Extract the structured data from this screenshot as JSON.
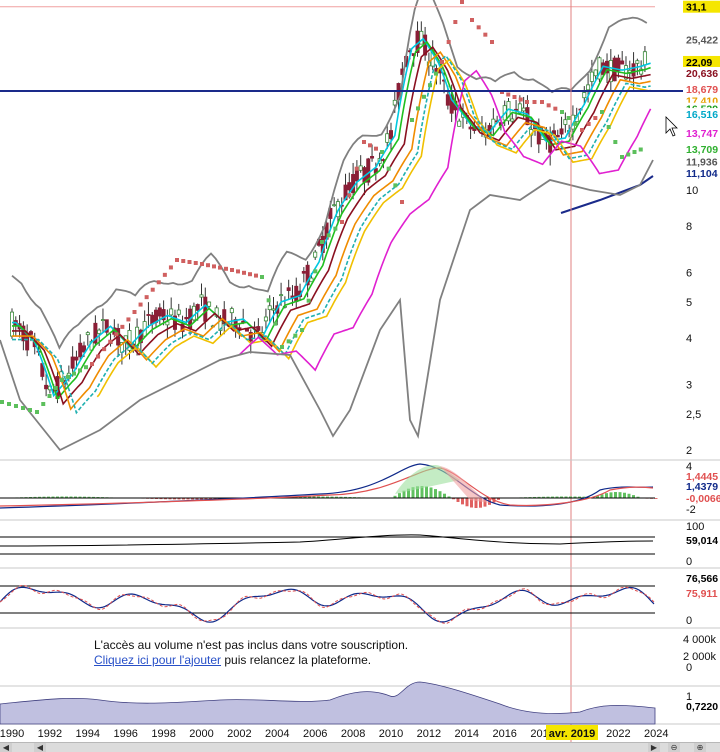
{
  "chart_data": [
    {
      "type": "candlestick",
      "panel": "price",
      "scale": "log",
      "ylim": [
        2,
        31.1
      ],
      "yticks": [
        2,
        2.5,
        3,
        4,
        5,
        6,
        8,
        10
      ],
      "x_ticks": [
        "1990",
        "1992",
        "1994",
        "1996",
        "1998",
        "2000",
        "2002",
        "2004",
        "2006",
        "2008",
        "2010",
        "2012",
        "2014",
        "2016",
        "2018",
        "2020",
        "2022",
        "2024"
      ],
      "cursor_label": "avr. 2019",
      "horizontal_levels": [
        31.1,
        18.67
      ],
      "value_tags": [
        {
          "text": "31,1",
          "value": 31.1,
          "bg": "#f5e600",
          "fg": "#000000"
        },
        {
          "text": "25,422",
          "value": 25.42,
          "bg": "#ffffff",
          "fg": "#555555"
        },
        {
          "text": "22,09",
          "value": 22.09,
          "bg": "#f5e600",
          "fg": "#000000"
        },
        {
          "text": "20,636",
          "value": 20.636,
          "bg": "#ffffff",
          "fg": "#8a1020"
        },
        {
          "text": "18,679",
          "value": 18.679,
          "bg": "#ffffff",
          "fg": "#e05050"
        },
        {
          "text": "17,410",
          "value": 17.41,
          "bg": "#ffffff",
          "fg": "#e8a000"
        },
        {
          "text": "16,539",
          "value": 16.54,
          "bg": "#ffffff",
          "fg": "#20a020"
        },
        {
          "text": "16,516",
          "value": 16.0,
          "bg": "#ffffff",
          "fg": "#00a8c8"
        },
        {
          "text": "13,747",
          "value": 14.25,
          "bg": "#ffffff",
          "fg": "#e020d0"
        },
        {
          "text": "13,709",
          "value": 12.9,
          "bg": "#ffffff",
          "fg": "#30b030"
        },
        {
          "text": "11,936",
          "value": 11.936,
          "bg": "#ffffff",
          "fg": "#555555"
        },
        {
          "text": "11,104",
          "value": 11.104,
          "bg": "#ffffff",
          "fg": "#102a8a"
        }
      ]
    },
    {
      "type": "histogram",
      "panel": "macd",
      "yticks": [
        4,
        -2
      ],
      "value_tags": [
        {
          "text": "1,4445",
          "fg": "#e05050"
        },
        {
          "text": "1,4379",
          "fg": "#102a8a"
        },
        {
          "text": "-0,0066",
          "fg": "#e05050"
        }
      ]
    },
    {
      "type": "line",
      "panel": "indicator",
      "yticks": [
        100,
        0
      ],
      "value_tags": [
        {
          "text": "59,014",
          "fg": "#000000"
        }
      ]
    },
    {
      "type": "line",
      "panel": "stochastic",
      "yticks": [
        0
      ],
      "value_tags": [
        {
          "text": "76,566",
          "fg": "#000000"
        },
        {
          "text": "75,911",
          "fg": "#e05050"
        }
      ]
    },
    {
      "type": "area",
      "panel": "volume",
      "yticks": [
        "4 000k",
        "2 000k",
        "0",
        "1"
      ],
      "value_tags": [
        {
          "text": "0,7220",
          "fg": "#000000"
        }
      ]
    }
  ],
  "notice": {
    "line1": "L'accès au volume n'est pas inclus dans votre souscription.",
    "link": "Cliquez ici pour l'ajouter",
    "rest": " puis relancez la plateforme."
  },
  "colors": {
    "up": "#3a8a3a",
    "down": "#8a1e36",
    "bollinger": "#808080",
    "sar": "#d06060",
    "sar_low": "#5cbf5c",
    "cursor": "#e08080",
    "level": "#1a2a8a"
  },
  "icons": {
    "scroll_left": "triangle-left",
    "scroll_right": "triangle-right",
    "zoom": "zoom-icon"
  }
}
